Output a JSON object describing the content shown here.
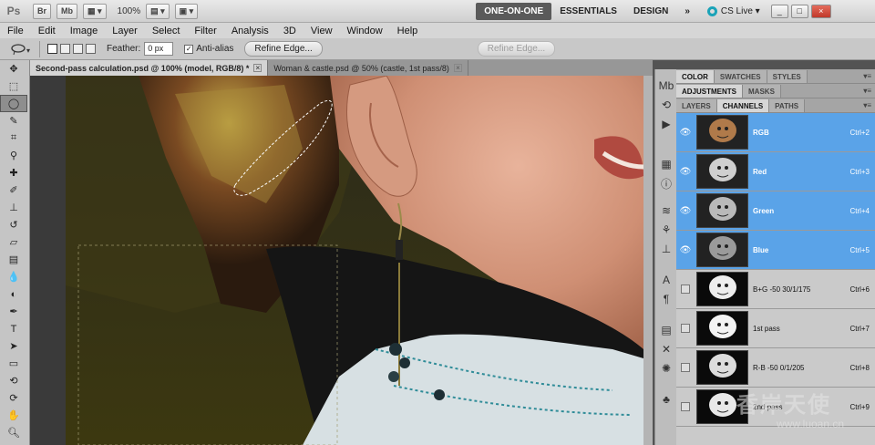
{
  "app": {
    "logo": "Ps",
    "bridge": "Br",
    "minibridge": "Mb",
    "zoom": "100%",
    "workspaces": [
      "ONE-ON-ONE",
      "ESSENTIALS",
      "DESIGN"
    ],
    "more": "»",
    "cslive": "CS Live",
    "win": [
      "_",
      "□",
      "×"
    ]
  },
  "menu": [
    "File",
    "Edit",
    "Image",
    "Layer",
    "Select",
    "Filter",
    "Analysis",
    "3D",
    "View",
    "Window",
    "Help"
  ],
  "options": {
    "feather_label": "Feather:",
    "feather_value": "0 px",
    "antialias_label": "Anti-alias",
    "refine_edge": "Refine Edge...",
    "refine_edge_dim": "Refine Edge..."
  },
  "tabs": [
    {
      "label": "Second-pass calculation.psd @ 100% (model, RGB/8) *",
      "close": "×"
    },
    {
      "label": "Woman & castle.psd @ 50% (castle, 1st pass/8)",
      "close": "×"
    }
  ],
  "tools": [
    "move-tool",
    "marquee-tool",
    "lasso-tool",
    "quick-select-tool",
    "crop-tool",
    "eyedropper-tool",
    "healing-tool",
    "brush-tool",
    "clone-stamp-tool",
    "history-brush-tool",
    "eraser-tool",
    "gradient-tool",
    "blur-tool",
    "dodge-tool",
    "pen-tool",
    "type-tool",
    "path-select-tool",
    "shape-tool",
    "3d-rotate-tool",
    "3d-orbit-tool",
    "hand-tool",
    "zoom-tool"
  ],
  "panels": {
    "row1": [
      "COLOR",
      "SWATCHES",
      "STYLES"
    ],
    "row2": [
      "ADJUSTMENTS",
      "MASKS"
    ],
    "row3": [
      "LAYERS",
      "CHANNELS",
      "PATHS"
    ]
  },
  "channels": [
    {
      "name": "RGB",
      "shortcut": "Ctrl+2",
      "selected": true,
      "visible": true
    },
    {
      "name": "Red",
      "shortcut": "Ctrl+3",
      "selected": true,
      "visible": true
    },
    {
      "name": "Green",
      "shortcut": "Ctrl+4",
      "selected": true,
      "visible": true
    },
    {
      "name": "Blue",
      "shortcut": "Ctrl+5",
      "selected": true,
      "visible": true
    },
    {
      "name": "B+G -50 30/1/175",
      "shortcut": "Ctrl+6",
      "selected": false,
      "visible": false
    },
    {
      "name": "1st pass",
      "shortcut": "Ctrl+7",
      "selected": false,
      "visible": false
    },
    {
      "name": "R-B -50 0/1/205",
      "shortcut": "Ctrl+8",
      "selected": false,
      "visible": false
    },
    {
      "name": "2nd pass",
      "shortcut": "Ctrl+9",
      "selected": false,
      "visible": false
    }
  ],
  "watermark": {
    "text": "香岸天使",
    "url": "www.luoan.cn"
  }
}
